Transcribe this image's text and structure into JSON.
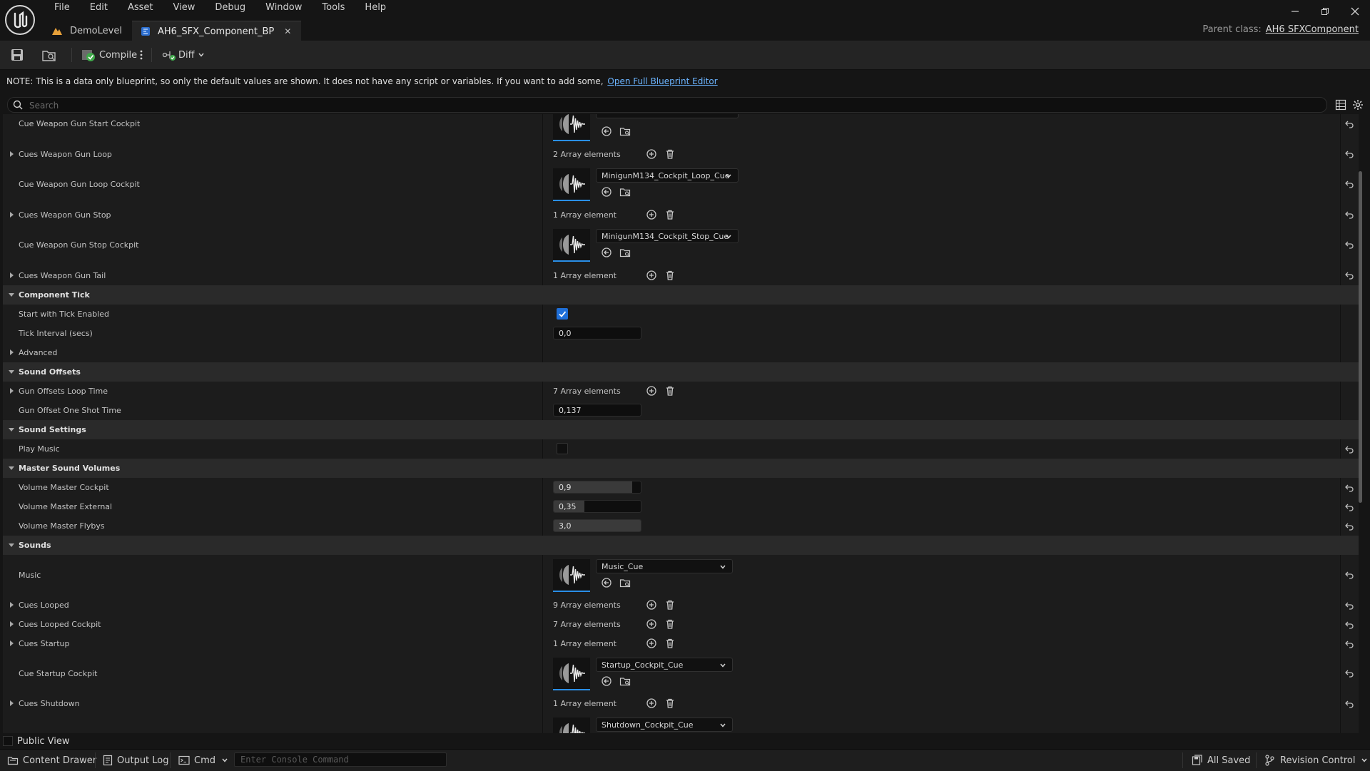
{
  "menu": [
    "File",
    "Edit",
    "Asset",
    "View",
    "Debug",
    "Window",
    "Tools",
    "Help"
  ],
  "tabs": {
    "level": "DemoLevel",
    "blueprint": "AH6_SFX_Component_BP",
    "close_glyph": "✕"
  },
  "parent_class": {
    "label": "Parent class:",
    "value": "AH6 SFXComponent"
  },
  "toolbar": {
    "compile": "Compile",
    "diff": "Diff"
  },
  "note": {
    "text": "NOTE: This is a data only blueprint, so only the default values are shown.  It does not have any script or variables.  If you want to add some,",
    "link": "Open Full Blueprint Editor"
  },
  "search": {
    "placeholder": "Search"
  },
  "rows": {
    "r1": {
      "label": "Cue Weapon Gun Start Cockpit"
    },
    "r2": {
      "label": "Cues Weapon Gun Loop",
      "value": "2 Array elements"
    },
    "r3": {
      "label": "Cue Weapon Gun Loop Cockpit",
      "asset": "MinigunM134_Cockpit_Loop_Cue"
    },
    "r4": {
      "label": "Cues Weapon Gun Stop",
      "value": "1 Array element"
    },
    "r5": {
      "label": "Cue Weapon Gun Stop Cockpit",
      "asset": "MinigunM134_Cockpit_Stop_Cue"
    },
    "r6": {
      "label": "Cues Weapon Gun Tail",
      "value": "1 Array element"
    },
    "r7": {
      "label": "Component Tick"
    },
    "r8": {
      "label": "Start with Tick Enabled",
      "checked": true
    },
    "r9": {
      "label": "Tick Interval (secs)",
      "value": "0,0"
    },
    "r10": {
      "label": "Advanced"
    },
    "r11": {
      "label": "Sound Offsets"
    },
    "r12": {
      "label": "Gun Offsets Loop Time",
      "value": "7 Array elements"
    },
    "r13": {
      "label": "Gun Offset One Shot Time",
      "value": "0,137"
    },
    "r14": {
      "label": "Sound Settings"
    },
    "r15": {
      "label": "Play Music",
      "checked": false
    },
    "r16": {
      "label": "Master Sound Volumes"
    },
    "r17": {
      "label": "Volume Master Cockpit",
      "value": "0,9",
      "fill": 0.9
    },
    "r18": {
      "label": "Volume Master External",
      "value": "0,35",
      "fill": 0.35
    },
    "r19": {
      "label": "Volume Master Flybys",
      "value": "3,0",
      "fill": 1.0
    },
    "r20": {
      "label": "Sounds"
    },
    "r21": {
      "label": "Music",
      "asset": "Music_Cue"
    },
    "r22": {
      "label": "Cues Looped",
      "value": "9 Array elements"
    },
    "r23": {
      "label": "Cues Looped Cockpit",
      "value": "7 Array elements"
    },
    "r24": {
      "label": "Cues Startup",
      "value": "1 Array element"
    },
    "r25": {
      "label": "Cue Startup Cockpit",
      "asset": "Startup_Cockpit_Cue"
    },
    "r26": {
      "label": "Cues Shutdown",
      "value": "1 Array element"
    },
    "r27": {
      "asset": "Shutdown_Cockpit_Cue"
    }
  },
  "public_view": "Public View",
  "statusbar": {
    "content_drawer": "Content Drawer",
    "output_log": "Output Log",
    "cmd": "Cmd",
    "console_placeholder": "Enter Console Command",
    "all_saved": "All Saved",
    "revision_control": "Revision Control"
  },
  "colors": {
    "accent": "#2a8fe8",
    "link": "#6bb4ff",
    "checkbox": "#1f6fd8"
  }
}
